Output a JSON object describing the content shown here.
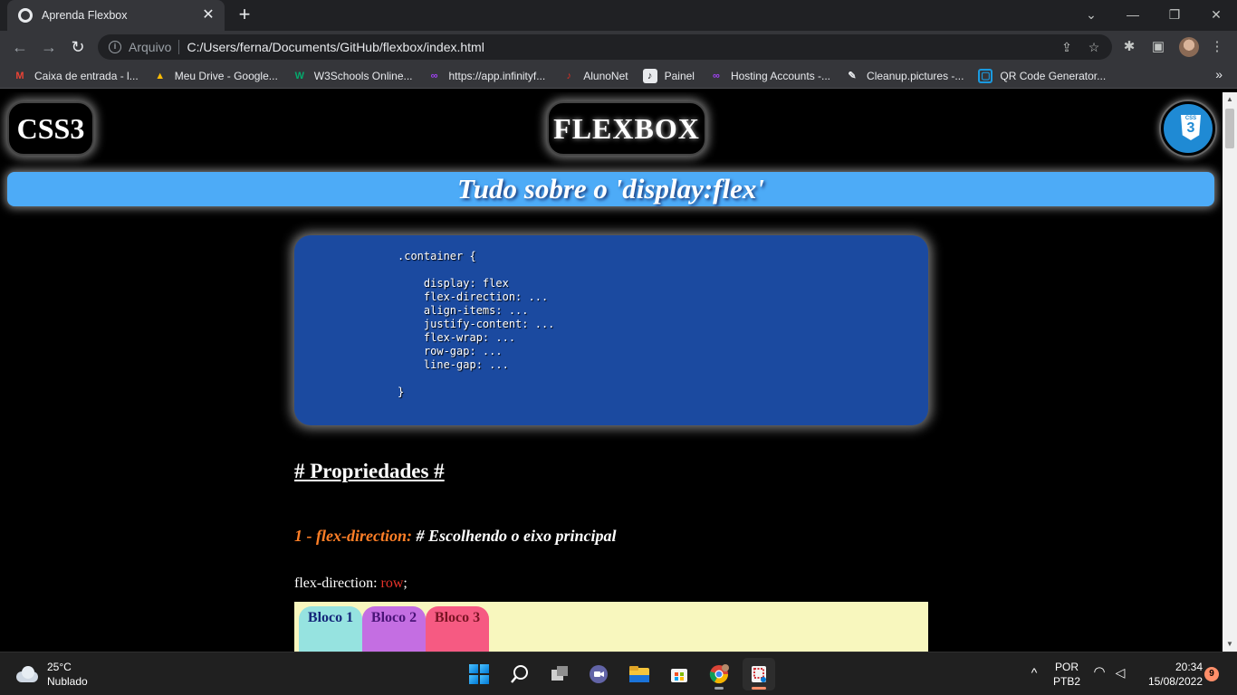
{
  "browser": {
    "tab_title": "Aprenda Flexbox",
    "tab_close": "✕",
    "new_tab": "+",
    "window_controls": {
      "chevron": "⌄",
      "minimize": "—",
      "restore": "❐",
      "close": "✕"
    },
    "nav": {
      "back": "←",
      "forward": "→",
      "reload": "↻"
    },
    "omnibox": {
      "info": "i",
      "scheme": "Arquivo",
      "url": "C:/Users/ferna/Documents/GitHub/flexbox/index.html"
    },
    "omnibox_icons": {
      "share": "⇪",
      "star": "☆"
    },
    "extensions": {
      "puzzle": "✱",
      "sidebar": "▣",
      "menu": "⋮"
    },
    "bookmarks": [
      {
        "label": "Caixa de entrada - l...",
        "icon": "gmail-icon",
        "glyph": "M",
        "color": "#ea4335"
      },
      {
        "label": "Meu Drive - Google...",
        "icon": "google-drive-icon",
        "glyph": "▲",
        "color": "#fbbc04"
      },
      {
        "label": "W3Schools Online...",
        "icon": "w3schools-icon",
        "glyph": "W",
        "color": "#04aa6d"
      },
      {
        "label": "https://app.infinityf...",
        "icon": "infinityfree-icon",
        "glyph": "∞",
        "color": "#a142f4"
      },
      {
        "label": "AlunoNet",
        "icon": "alunonet-icon",
        "glyph": "♪",
        "color": "#d93025"
      },
      {
        "label": "Painel",
        "icon": "painel-icon",
        "glyph": "♪",
        "color": "#e8eaed"
      },
      {
        "label": "Hosting Accounts -...",
        "icon": "hosting-icon",
        "glyph": "∞",
        "color": "#a142f4"
      },
      {
        "label": "Cleanup.pictures -...",
        "icon": "cleanup-icon",
        "glyph": "✎",
        "color": "#e8eaed"
      },
      {
        "label": "QR Code Generator...",
        "icon": "qr-code-icon",
        "glyph": "▢",
        "color": "#1a9ae0"
      }
    ],
    "bookmarks_more": "»"
  },
  "page": {
    "logo_left": "CSS3",
    "logo_center": "FLEXBOX",
    "badge_text": "CSS",
    "badge_num": "3",
    "banner": "Tudo sobre o 'display:flex'",
    "code": ".container {\n\n    display: flex\n    flex-direction: ...\n    align-items: ...\n    justify-content: ...\n    flex-wrap: ...\n    row-gap: ...\n    line-gap: ...\n\n}",
    "section_title": "# Propriedades #",
    "prop1": {
      "num": "1 - flex-direction:",
      "desc": " # Escolhendo o eixo principal"
    },
    "prop1_line": {
      "label": "flex-direction: ",
      "value": "row",
      "end": ";"
    },
    "blocks": [
      "Bloco 1",
      "Bloco 2",
      "Bloco 3"
    ]
  },
  "scrollbar": {
    "up": "▲",
    "down": "▼"
  },
  "taskbar": {
    "weather_temp": "25°C",
    "weather_desc": "Nublado",
    "lang": "POR",
    "layout": "PTB2",
    "time": "20:34",
    "date": "15/08/2022",
    "notifications": "9",
    "tray_chevron": "^",
    "wifi": "◠",
    "volume": "◁"
  }
}
